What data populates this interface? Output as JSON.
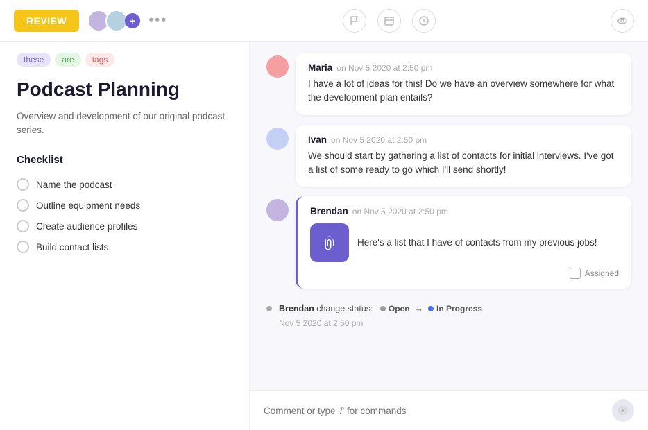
{
  "topbar": {
    "review_label": "REVIEW",
    "dots": "•••",
    "toolbar_icons": [
      "flag",
      "calendar",
      "clock"
    ],
    "eye_label": "eye"
  },
  "left": {
    "tags": [
      {
        "id": "these",
        "label": "these",
        "class": "tag-these"
      },
      {
        "id": "are",
        "label": "are",
        "class": "tag-are"
      },
      {
        "id": "tags",
        "label": "tags",
        "class": "tag-tags"
      }
    ],
    "title": "Podcast Planning",
    "description": "Overview and development of our original podcast series.",
    "checklist_title": "Checklist",
    "checklist_items": [
      "Name the podcast",
      "Outline equipment needs",
      "Create audience profiles",
      "Build contact lists"
    ]
  },
  "comments": [
    {
      "id": "maria",
      "author": "Maria",
      "time": "on Nov 5 2020 at 2:50 pm",
      "body": "I have a lot of ideas for this! Do we have an overview somewhere for what the development plan entails?",
      "avatar_class": "avatar-maria",
      "highlighted": false
    },
    {
      "id": "ivan",
      "author": "Ivan",
      "time": "on Nov 5 2020 at 2:50 pm",
      "body": "We should start by gathering a list of contacts for initial interviews. I've got a list of some ready to go which I'll send shortly!",
      "avatar_class": "avatar-ivan",
      "highlighted": false
    },
    {
      "id": "brendan",
      "author": "Brendan",
      "time": "on Nov 5 2020 at 2:50 pm",
      "body": "Here's a list that I have of contacts from my previous jobs!",
      "avatar_class": "avatar-brendan",
      "highlighted": true,
      "has_attachment": true,
      "assigned_label": "Assigned"
    }
  ],
  "status_change": {
    "author": "Brendan",
    "action": "change status:",
    "from": "Open",
    "to": "In Progress",
    "time": "Nov 5 2020 at 2:50 pm"
  },
  "input": {
    "placeholder": "Comment or type '/' for commands"
  }
}
